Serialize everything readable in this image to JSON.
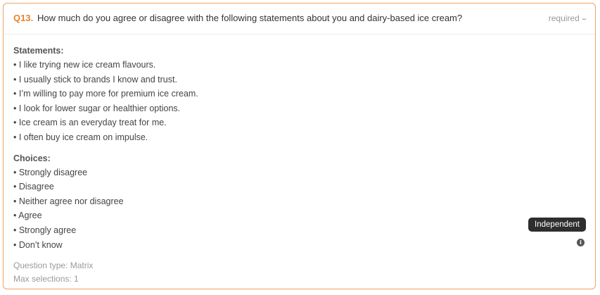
{
  "question": {
    "number": "Q13.",
    "text": "How much do you agree or disagree with the following statements about you and dairy-based ice cream?",
    "required_label": "required",
    "required_icon": "chevron-down-icon"
  },
  "statements": {
    "title": "Statements:",
    "items": [
      "• I like trying new ice cream flavours.",
      "• I usually stick to brands I know and trust.",
      "• I’m willing to pay more for premium ice cream.",
      "• I look for lower sugar or healthier options.",
      "• Ice cream is an everyday treat for me.",
      "• I often buy ice cream on impulse."
    ]
  },
  "choices": {
    "title": "Choices:",
    "items": [
      "• Strongly disagree",
      "• Disagree",
      "• Neither agree nor disagree",
      "• Agree",
      "• Strongly agree",
      "• Don’t know"
    ]
  },
  "meta": {
    "question_type": "Question type: Matrix",
    "max_selections": "Max selections: 1"
  },
  "tooltip": {
    "label": "Independent",
    "icon": "info-icon"
  },
  "colors": {
    "accent": "#e8832a",
    "border": "#f0a35e",
    "tooltip_bg": "#2e2e2e"
  }
}
